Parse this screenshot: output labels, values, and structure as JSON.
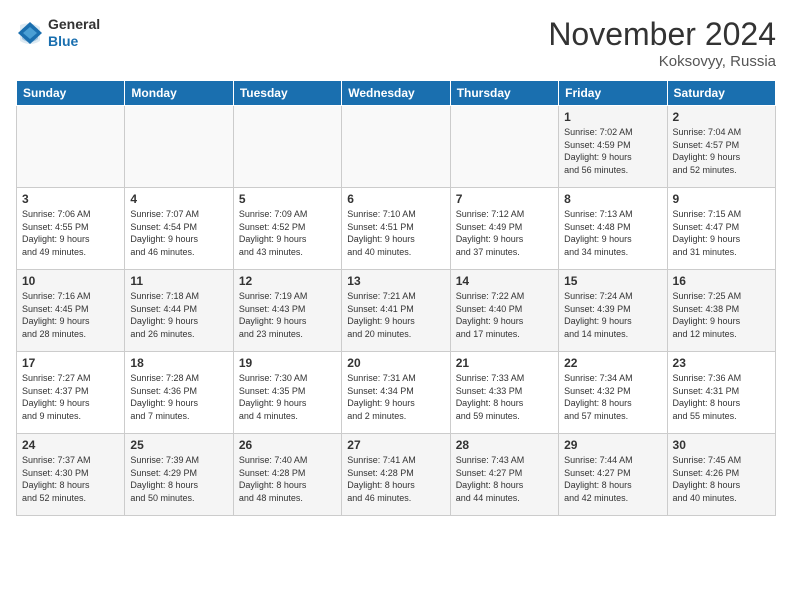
{
  "logo": {
    "general": "General",
    "blue": "Blue"
  },
  "title": "November 2024",
  "location": "Koksovyy, Russia",
  "days_of_week": [
    "Sunday",
    "Monday",
    "Tuesday",
    "Wednesday",
    "Thursday",
    "Friday",
    "Saturday"
  ],
  "weeks": [
    [
      {
        "day": "",
        "info": ""
      },
      {
        "day": "",
        "info": ""
      },
      {
        "day": "",
        "info": ""
      },
      {
        "day": "",
        "info": ""
      },
      {
        "day": "",
        "info": ""
      },
      {
        "day": "1",
        "info": "Sunrise: 7:02 AM\nSunset: 4:59 PM\nDaylight: 9 hours\nand 56 minutes."
      },
      {
        "day": "2",
        "info": "Sunrise: 7:04 AM\nSunset: 4:57 PM\nDaylight: 9 hours\nand 52 minutes."
      }
    ],
    [
      {
        "day": "3",
        "info": "Sunrise: 7:06 AM\nSunset: 4:55 PM\nDaylight: 9 hours\nand 49 minutes."
      },
      {
        "day": "4",
        "info": "Sunrise: 7:07 AM\nSunset: 4:54 PM\nDaylight: 9 hours\nand 46 minutes."
      },
      {
        "day": "5",
        "info": "Sunrise: 7:09 AM\nSunset: 4:52 PM\nDaylight: 9 hours\nand 43 minutes."
      },
      {
        "day": "6",
        "info": "Sunrise: 7:10 AM\nSunset: 4:51 PM\nDaylight: 9 hours\nand 40 minutes."
      },
      {
        "day": "7",
        "info": "Sunrise: 7:12 AM\nSunset: 4:49 PM\nDaylight: 9 hours\nand 37 minutes."
      },
      {
        "day": "8",
        "info": "Sunrise: 7:13 AM\nSunset: 4:48 PM\nDaylight: 9 hours\nand 34 minutes."
      },
      {
        "day": "9",
        "info": "Sunrise: 7:15 AM\nSunset: 4:47 PM\nDaylight: 9 hours\nand 31 minutes."
      }
    ],
    [
      {
        "day": "10",
        "info": "Sunrise: 7:16 AM\nSunset: 4:45 PM\nDaylight: 9 hours\nand 28 minutes."
      },
      {
        "day": "11",
        "info": "Sunrise: 7:18 AM\nSunset: 4:44 PM\nDaylight: 9 hours\nand 26 minutes."
      },
      {
        "day": "12",
        "info": "Sunrise: 7:19 AM\nSunset: 4:43 PM\nDaylight: 9 hours\nand 23 minutes."
      },
      {
        "day": "13",
        "info": "Sunrise: 7:21 AM\nSunset: 4:41 PM\nDaylight: 9 hours\nand 20 minutes."
      },
      {
        "day": "14",
        "info": "Sunrise: 7:22 AM\nSunset: 4:40 PM\nDaylight: 9 hours\nand 17 minutes."
      },
      {
        "day": "15",
        "info": "Sunrise: 7:24 AM\nSunset: 4:39 PM\nDaylight: 9 hours\nand 14 minutes."
      },
      {
        "day": "16",
        "info": "Sunrise: 7:25 AM\nSunset: 4:38 PM\nDaylight: 9 hours\nand 12 minutes."
      }
    ],
    [
      {
        "day": "17",
        "info": "Sunrise: 7:27 AM\nSunset: 4:37 PM\nDaylight: 9 hours\nand 9 minutes."
      },
      {
        "day": "18",
        "info": "Sunrise: 7:28 AM\nSunset: 4:36 PM\nDaylight: 9 hours\nand 7 minutes."
      },
      {
        "day": "19",
        "info": "Sunrise: 7:30 AM\nSunset: 4:35 PM\nDaylight: 9 hours\nand 4 minutes."
      },
      {
        "day": "20",
        "info": "Sunrise: 7:31 AM\nSunset: 4:34 PM\nDaylight: 9 hours\nand 2 minutes."
      },
      {
        "day": "21",
        "info": "Sunrise: 7:33 AM\nSunset: 4:33 PM\nDaylight: 8 hours\nand 59 minutes."
      },
      {
        "day": "22",
        "info": "Sunrise: 7:34 AM\nSunset: 4:32 PM\nDaylight: 8 hours\nand 57 minutes."
      },
      {
        "day": "23",
        "info": "Sunrise: 7:36 AM\nSunset: 4:31 PM\nDaylight: 8 hours\nand 55 minutes."
      }
    ],
    [
      {
        "day": "24",
        "info": "Sunrise: 7:37 AM\nSunset: 4:30 PM\nDaylight: 8 hours\nand 52 minutes."
      },
      {
        "day": "25",
        "info": "Sunrise: 7:39 AM\nSunset: 4:29 PM\nDaylight: 8 hours\nand 50 minutes."
      },
      {
        "day": "26",
        "info": "Sunrise: 7:40 AM\nSunset: 4:28 PM\nDaylight: 8 hours\nand 48 minutes."
      },
      {
        "day": "27",
        "info": "Sunrise: 7:41 AM\nSunset: 4:28 PM\nDaylight: 8 hours\nand 46 minutes."
      },
      {
        "day": "28",
        "info": "Sunrise: 7:43 AM\nSunset: 4:27 PM\nDaylight: 8 hours\nand 44 minutes."
      },
      {
        "day": "29",
        "info": "Sunrise: 7:44 AM\nSunset: 4:27 PM\nDaylight: 8 hours\nand 42 minutes."
      },
      {
        "day": "30",
        "info": "Sunrise: 7:45 AM\nSunset: 4:26 PM\nDaylight: 8 hours\nand 40 minutes."
      }
    ]
  ]
}
